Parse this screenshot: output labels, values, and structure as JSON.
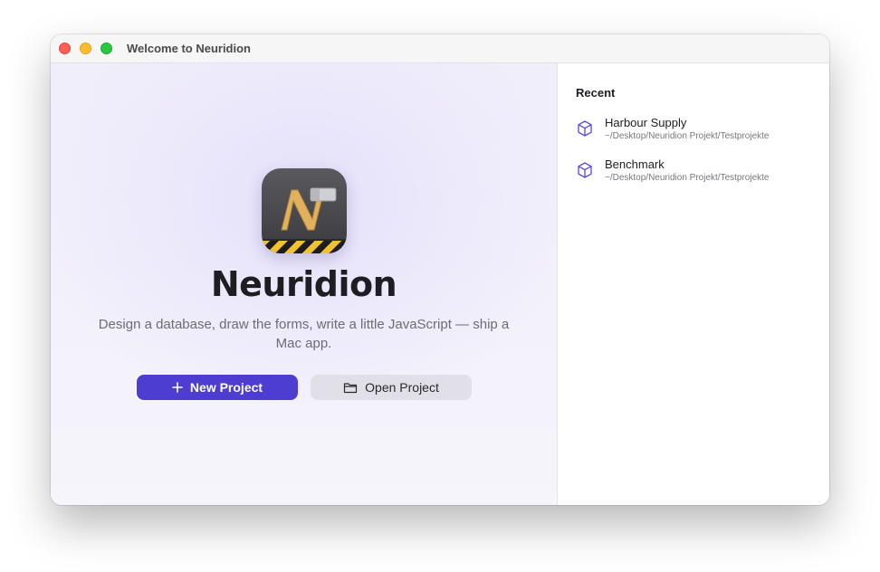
{
  "window": {
    "title": "Welcome to Neuridion"
  },
  "welcome": {
    "app_name": "Neuridion",
    "tagline": "Design a database, draw the forms, write a little JavaScript — ship a Mac app.",
    "app_icon": "neuridion-app-icon",
    "accent_color": "#4d3dd0",
    "new_project_label": "New Project",
    "new_project_icon": "plus-icon",
    "open_project_label": "Open Project",
    "open_project_icon": "folder-icon"
  },
  "recent": {
    "heading": "Recent",
    "item_icon": "cube-icon",
    "items": [
      {
        "name": "Harbour Supply",
        "path": "~/Desktop/Neuridion Projekt/Testprojekte"
      },
      {
        "name": "Benchmark",
        "path": "~/Desktop/Neuridion Projekt/Testprojekte"
      }
    ]
  }
}
